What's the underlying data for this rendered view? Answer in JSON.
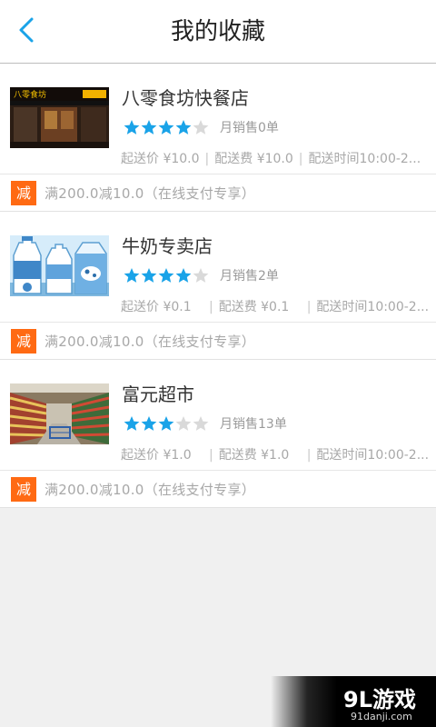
{
  "header": {
    "title": "我的收藏",
    "back_icon": "chevron-left-icon",
    "accent": "#1aa3e8"
  },
  "colors": {
    "star_on": "#1aa3e8",
    "star_off": "#d9d9d9",
    "promo_badge": "#ff6a13"
  },
  "stores": [
    {
      "name": "八零食坊快餐店",
      "rating": 4,
      "monthly_sales": "月销售0单",
      "min_price": "起送价 ¥10.0",
      "delivery_fee": "配送费 ¥10.0",
      "delivery_time": "配送时间10:00-2...",
      "promo_badge": "减",
      "promo_text": "满200.0减10.0（在线支付专享）",
      "image": {
        "sign_text": "八零食坊"
      }
    },
    {
      "name": "牛奶专卖店",
      "rating": 4,
      "monthly_sales": "月销售2单",
      "min_price": "起送价 ¥0.1   ",
      "delivery_fee": "配送费 ¥0.1   ",
      "delivery_time": "配送时间10:00-2...",
      "promo_badge": "减",
      "promo_text": "满200.0减10.0（在线支付专享）"
    },
    {
      "name": "富元超市",
      "rating": 3,
      "monthly_sales": "月销售13单",
      "min_price": "起送价 ¥1.0   ",
      "delivery_fee": "配送费 ¥1.0   ",
      "delivery_time": "配送时间10:00-2...",
      "promo_badge": "减",
      "promo_text": "满200.0减10.0（在线支付专享）"
    }
  ],
  "watermark": {
    "logo": "9L游戏",
    "url": "91danji.com"
  }
}
